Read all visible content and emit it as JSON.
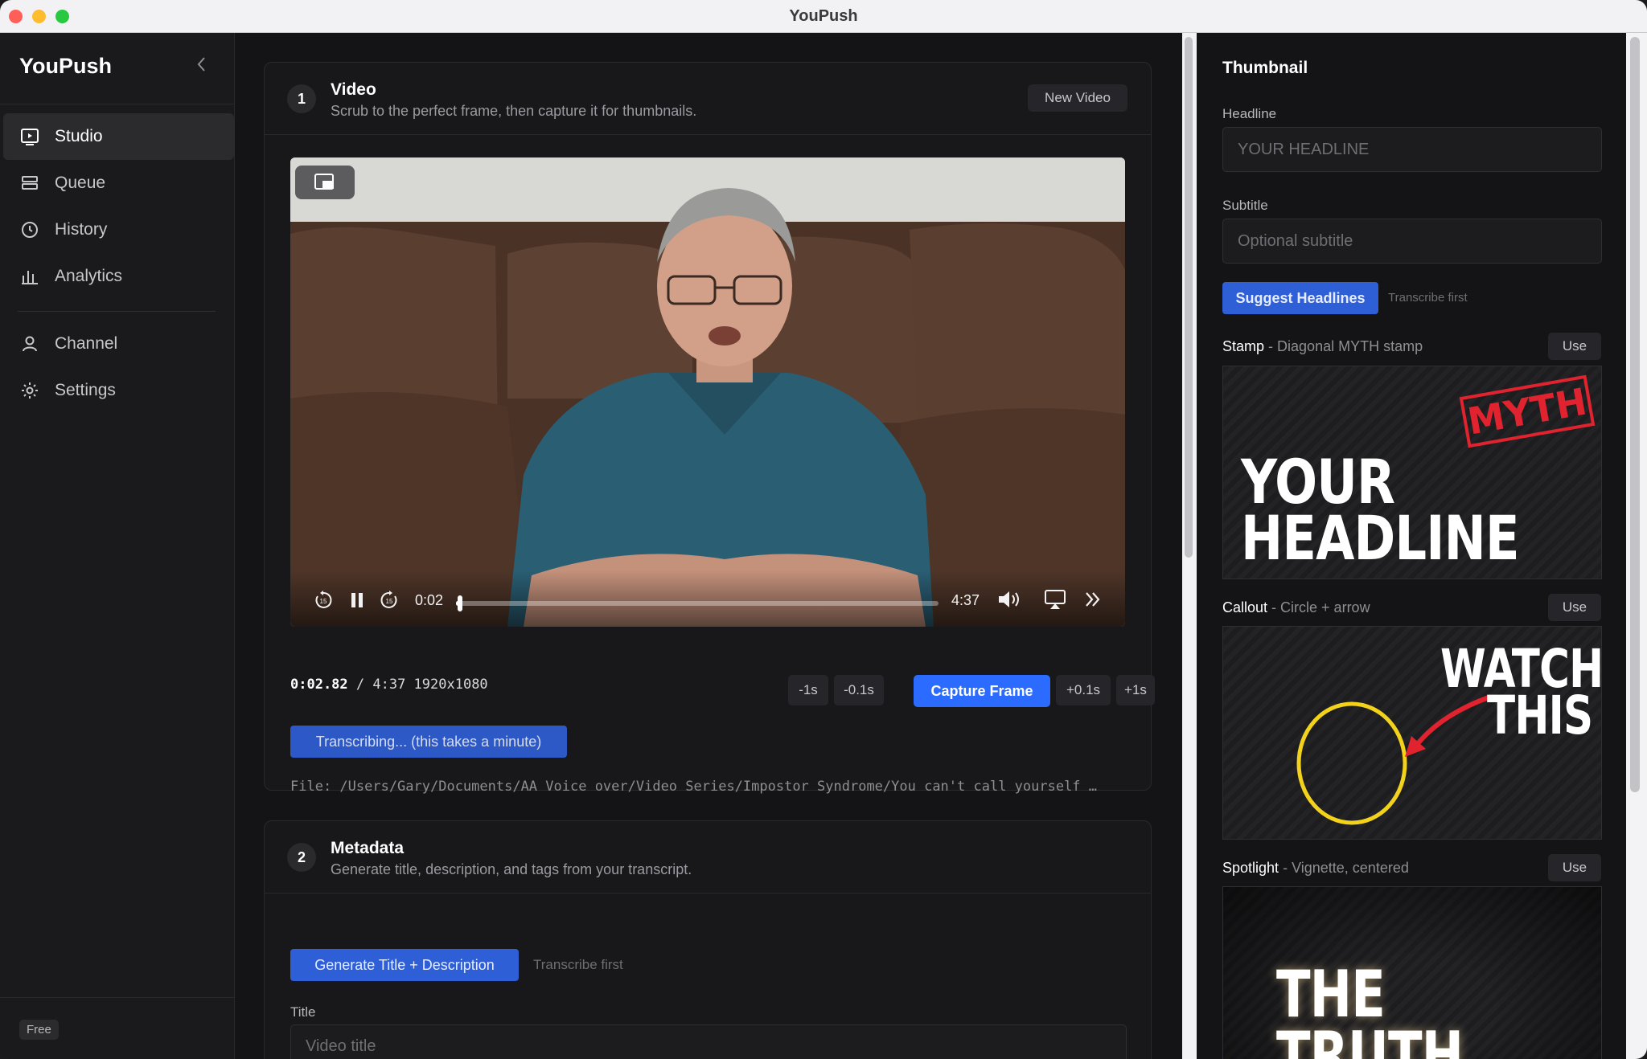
{
  "window": {
    "title": "YouPush"
  },
  "sidebar": {
    "brand": "YouPush",
    "items": [
      {
        "label": "Studio",
        "icon": "studio-icon",
        "active": true
      },
      {
        "label": "Queue",
        "icon": "queue-icon"
      },
      {
        "label": "History",
        "icon": "history-icon"
      },
      {
        "label": "Analytics",
        "icon": "analytics-icon"
      },
      {
        "label": "Channel",
        "icon": "user-icon"
      },
      {
        "label": "Settings",
        "icon": "gear-icon"
      }
    ],
    "plan": "Free"
  },
  "video_card": {
    "step": "1",
    "title": "Video",
    "subtitle": "Scrub to the perfect frame, then capture it for thumbnails.",
    "new_video_label": "New Video",
    "player": {
      "current": "0:02",
      "duration": "4:37",
      "progress": 0.008
    },
    "timecode": "0:02.82",
    "timecode_rest": "/ 4:37 1920x1080",
    "step_buttons": [
      "-1s",
      "-0.1s",
      "+0.1s",
      "+1s"
    ],
    "capture_label": "Capture Frame",
    "transcribing_label": "Transcribing... (this takes a minute)",
    "file_path": "File: /Users/Gary/Documents/AA Voice over/Video Series/Impostor Syndrome/You can't call yourself …"
  },
  "metadata_card": {
    "step": "2",
    "title": "Metadata",
    "subtitle": "Generate title, description, and tags from your transcript.",
    "generate_label": "Generate Title + Description",
    "hint": "Transcribe first",
    "title_label": "Title",
    "title_placeholder": "Video title"
  },
  "thumbnail": {
    "title": "Thumbnail",
    "headline_label": "Headline",
    "headline_placeholder": "YOUR HEADLINE",
    "subtitle_label": "Subtitle",
    "subtitle_placeholder": "Optional subtitle",
    "suggest_label": "Suggest Headlines",
    "suggest_hint": "Transcribe first",
    "templates": [
      {
        "name": "Stamp",
        "desc": "- Diagonal MYTH stamp",
        "use": "Use",
        "stamp": "MYTH",
        "line1": "YOUR",
        "line2": "HEADLINE"
      },
      {
        "name": "Callout",
        "desc": "- Circle + arrow",
        "use": "Use",
        "line1": "WATCH",
        "line2": "THIS"
      },
      {
        "name": "Spotlight",
        "desc": "- Vignette, centered",
        "use": "Use",
        "line1": "THE TRUTH"
      }
    ]
  },
  "colors": {
    "accent": "#2b6bff",
    "button_blue": "#2f5fd6",
    "stamp_red": "#e0232e",
    "callout_yellow": "#f2d21b",
    "arrow_red": "#e0232e"
  }
}
